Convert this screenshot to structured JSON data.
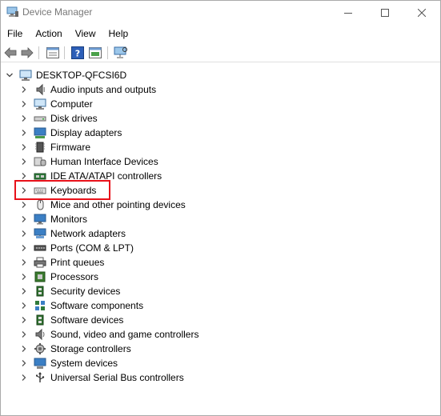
{
  "window": {
    "title": "Device Manager"
  },
  "menu": [
    "File",
    "Action",
    "View",
    "Help"
  ],
  "tree": {
    "root": "DESKTOP-QFCSI6D",
    "categories": [
      {
        "label": "Audio inputs and outputs",
        "icon": "speaker-icon"
      },
      {
        "label": "Computer",
        "icon": "computer-icon"
      },
      {
        "label": "Disk drives",
        "icon": "disk-drive-icon"
      },
      {
        "label": "Display adapters",
        "icon": "display-adapter-icon"
      },
      {
        "label": "Firmware",
        "icon": "firmware-chip-icon"
      },
      {
        "label": "Human Interface Devices",
        "icon": "hid-icon"
      },
      {
        "label": "IDE ATA/ATAPI controllers",
        "icon": "ide-controller-icon"
      },
      {
        "label": "Keyboards",
        "icon": "keyboard-icon"
      },
      {
        "label": "Mice and other pointing devices",
        "icon": "mouse-icon"
      },
      {
        "label": "Monitors",
        "icon": "monitor-icon"
      },
      {
        "label": "Network adapters",
        "icon": "network-adapter-icon"
      },
      {
        "label": "Ports (COM & LPT)",
        "icon": "port-icon"
      },
      {
        "label": "Print queues",
        "icon": "printer-icon"
      },
      {
        "label": "Processors",
        "icon": "processor-icon"
      },
      {
        "label": "Security devices",
        "icon": "security-device-icon"
      },
      {
        "label": "Software components",
        "icon": "software-component-icon"
      },
      {
        "label": "Software devices",
        "icon": "software-device-icon"
      },
      {
        "label": "Sound, video and game controllers",
        "icon": "sound-controller-icon"
      },
      {
        "label": "Storage controllers",
        "icon": "storage-controller-icon"
      },
      {
        "label": "System devices",
        "icon": "system-device-icon"
      },
      {
        "label": "Universal Serial Bus controllers",
        "icon": "usb-icon"
      }
    ],
    "highlighted": "Keyboards",
    "highlight_color": "#e8111a"
  },
  "toolbar": [
    "back-arrow-icon",
    "forward-arrow-icon",
    "properties-icon",
    "help-icon",
    "update-driver-icon",
    "scan-monitor-icon"
  ]
}
